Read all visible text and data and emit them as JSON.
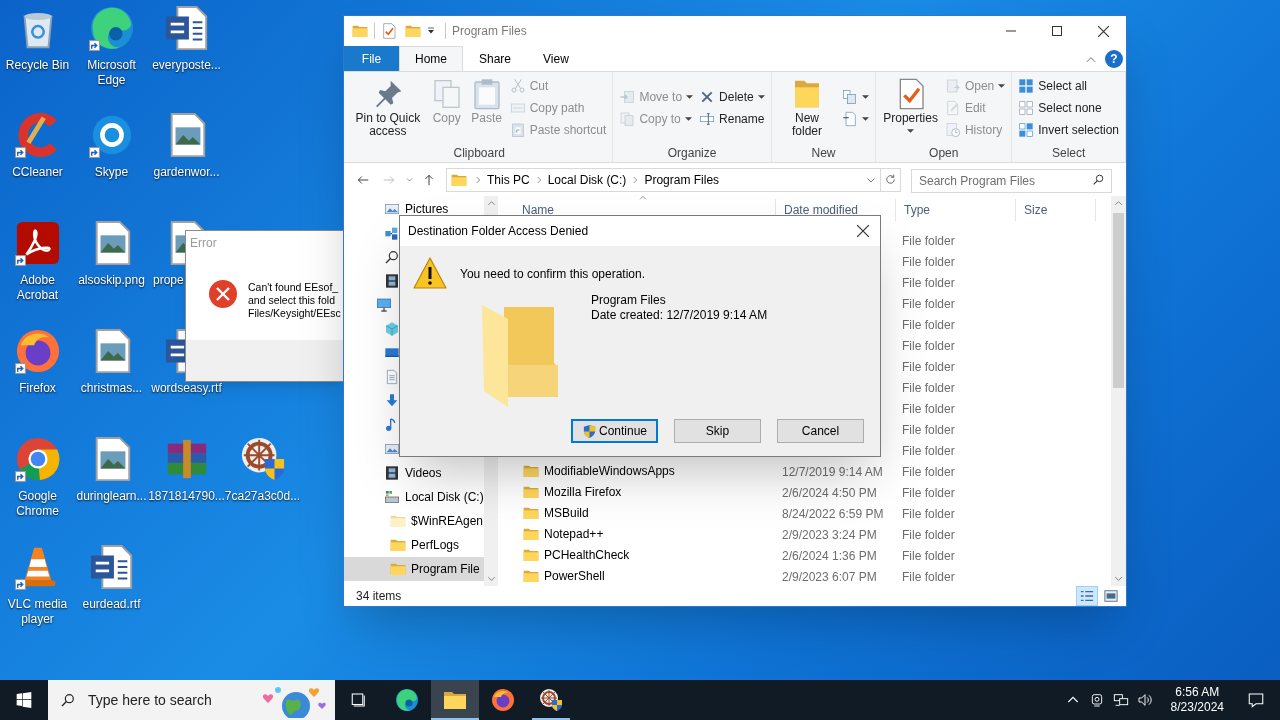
{
  "desktop_icons": [
    {
      "label": "Recycle Bin",
      "kind": "recycle",
      "shortcut": false
    },
    {
      "label": "CCleaner",
      "kind": "ccleaner",
      "shortcut": true
    },
    {
      "label": "Adobe Acrobat",
      "kind": "acrobat",
      "shortcut": true
    },
    {
      "label": "Firefox",
      "kind": "firefox",
      "shortcut": true
    },
    {
      "label": "Google Chrome",
      "kind": "chrome",
      "shortcut": true
    },
    {
      "label": "VLC media player",
      "kind": "vlc",
      "shortcut": true
    },
    {
      "label": "Microsoft Edge",
      "kind": "edge",
      "shortcut": true
    },
    {
      "label": "Skype",
      "kind": "skype",
      "shortcut": true
    },
    {
      "label": "alsoskip.png",
      "kind": "image",
      "shortcut": false
    },
    {
      "label": "christmas...",
      "kind": "image",
      "shortcut": false
    },
    {
      "label": "duringlearn...",
      "kind": "image",
      "shortcut": false
    },
    {
      "label": "eurdead.rtf",
      "kind": "word",
      "shortcut": false
    },
    {
      "label": "everyposte...",
      "kind": "word",
      "shortcut": false
    },
    {
      "label": "gardenwor...",
      "kind": "image",
      "shortcut": false
    },
    {
      "label": "prope",
      "kind": "image",
      "shortcut": false
    },
    {
      "label": "wordseasy.rtf",
      "kind": "word",
      "shortcut": false
    },
    {
      "label": "1871814790...",
      "kind": "winrar",
      "shortcut": false
    },
    {
      "label": "7ca27a3c0d...",
      "kind": "setup",
      "shortcut": false
    }
  ],
  "error_window": {
    "title": "Error",
    "message_lines": [
      "Can't found EEsof_",
      "and select this fold",
      "Files/Keysight/EEsc"
    ]
  },
  "explorer": {
    "title": "Program Files",
    "help": "?",
    "tabs": [
      {
        "label": "File",
        "kind": "file",
        "selected": false
      },
      {
        "label": "Home",
        "kind": "tab",
        "selected": true
      },
      {
        "label": "Share",
        "kind": "tab",
        "selected": false
      },
      {
        "label": "View",
        "kind": "tab",
        "selected": false
      }
    ],
    "ribbon_groups": [
      {
        "label": "Clipboard",
        "columns": [
          [
            {
              "label": "Pin to Quick access",
              "kind": "pin",
              "disabled": false,
              "dropdown": false
            }
          ],
          [
            {
              "label": "Copy",
              "kind": "copy",
              "disabled": true,
              "dropdown": false
            }
          ],
          [
            {
              "label": "Paste",
              "kind": "paste",
              "disabled": true,
              "dropdown": false
            }
          ],
          [
            {
              "label": "Cut",
              "kind": "cut",
              "disabled": true,
              "dropdown": false
            },
            {
              "label": "Copy path",
              "kind": "copypath",
              "disabled": true,
              "dropdown": false
            },
            {
              "label": "Paste shortcut",
              "kind": "pasteshortcut",
              "disabled": true,
              "dropdown": false
            }
          ]
        ]
      },
      {
        "label": "Organize",
        "columns": [
          [
            {
              "label": "Move to",
              "kind": "moveto",
              "disabled": true,
              "dropdown": true
            },
            {
              "label": "Copy to",
              "kind": "copyto",
              "disabled": true,
              "dropdown": true
            }
          ],
          [
            {
              "label": "Delete",
              "kind": "delete",
              "disabled": false,
              "dropdown": true
            },
            {
              "label": "Rename",
              "kind": "rename",
              "disabled": false,
              "dropdown": false
            }
          ]
        ]
      },
      {
        "label": "New",
        "columns": [
          [
            {
              "label": "New folder",
              "kind": "newfolder",
              "disabled": false,
              "dropdown": false
            }
          ],
          [
            {
              "kind": "newitem",
              "disabled": false,
              "dropdown": true
            },
            {
              "kind": "easyaccess",
              "disabled": false,
              "dropdown": true
            }
          ]
        ]
      },
      {
        "label": "Open",
        "columns": [
          [
            {
              "label": "Properties",
              "kind": "properties",
              "disabled": false,
              "dropdown": true
            }
          ],
          [
            {
              "label": "Open",
              "kind": "open",
              "disabled": true,
              "dropdown": true
            },
            {
              "label": "Edit",
              "kind": "edit",
              "disabled": true,
              "dropdown": false
            },
            {
              "label": "History",
              "kind": "history",
              "disabled": true,
              "dropdown": false
            }
          ]
        ]
      },
      {
        "label": "Select",
        "columns": [
          [
            {
              "label": "Select all",
              "kind": "selectall",
              "disabled": false,
              "dropdown": false
            },
            {
              "label": "Select none",
              "kind": "selectnone",
              "disabled": false,
              "dropdown": false
            },
            {
              "label": "Invert selection",
              "kind": "invert",
              "disabled": false,
              "dropdown": false
            }
          ]
        ]
      }
    ],
    "address": {
      "crumbs": [
        "This PC",
        "Local Disk (C:)",
        "Program Files"
      ],
      "search_placeholder": "Search Program Files"
    },
    "quick_access": [
      {
        "label": "Pictures",
        "kind": "pictures",
        "selected": false
      },
      {
        "kind": "blocks",
        "selected": false
      },
      {
        "kind": "search",
        "selected": false
      },
      {
        "kind": "film",
        "selected": false
      }
    ],
    "this_pc": {
      "kind": "pc",
      "selected": false,
      "children": [
        {
          "kind": "cube",
          "selected": false
        },
        {
          "kind": "desktop",
          "selected": false
        },
        {
          "kind": "document",
          "selected": false
        },
        {
          "kind": "download",
          "selected": false
        },
        {
          "kind": "music",
          "selected": false
        },
        {
          "kind": "pictures",
          "selected": false
        },
        {
          "label": "Videos",
          "kind": "film",
          "selected": false
        },
        {
          "label": "Local Disk (C:)",
          "kind": "disk",
          "selected": false,
          "children": [
            {
              "label": "$WinREAgen",
              "kind": "folder_light",
              "selected": false
            },
            {
              "label": "PerfLogs",
              "kind": "folder",
              "selected": false
            },
            {
              "label": "Program File",
              "kind": "folder",
              "selected": true
            }
          ]
        }
      ]
    },
    "columns": [
      {
        "label": "Name",
        "sorted": true
      },
      {
        "label": "Date modified",
        "sorted": false
      },
      {
        "label": "Type",
        "sorted": false
      },
      {
        "label": "Size",
        "sorted": false
      }
    ],
    "rows": [
      {
        "type": "File folder"
      },
      {
        "type": "File folder"
      },
      {
        "type": "File folder"
      },
      {
        "type": "File folder"
      },
      {
        "type": "File folder"
      },
      {
        "type": "File folder"
      },
      {
        "type": "File folder"
      },
      {
        "type": "File folder"
      },
      {
        "type": "File folder"
      },
      {
        "type": "File folder"
      },
      {
        "type": "File folder"
      },
      {
        "name": "ModifiableWindowsApps",
        "date": "12/7/2019 9:14 AM",
        "type": "File folder"
      },
      {
        "name": "Mozilla Firefox",
        "date": "2/6/2024 4:50 PM",
        "type": "File folder"
      },
      {
        "name": "MSBuild",
        "date": "8/24/2022 6:59 PM",
        "type": "File folder"
      },
      {
        "name": "Notepad++",
        "date": "2/9/2023 3:24 PM",
        "type": "File folder"
      },
      {
        "name": "PCHealthCheck",
        "date": "2/6/2024 1:36 PM",
        "type": "File folder"
      },
      {
        "name": "PowerShell",
        "date": "2/9/2023 6:07 PM",
        "type": "File folder"
      }
    ],
    "status": {
      "item_count": "34 items",
      "views": [
        {
          "kind": "details",
          "selected": true
        },
        {
          "kind": "large_icons",
          "selected": false
        }
      ]
    }
  },
  "dialog": {
    "title": "Destination Folder Access Denied",
    "message": "You need to confirm this operation.",
    "item_name": "Program Files",
    "item_detail": "Date created: 12/7/2019 9:14 AM",
    "buttons": [
      {
        "label": "Continue",
        "shield": true,
        "default": true
      },
      {
        "label": "Skip",
        "shield": false,
        "default": false
      },
      {
        "label": "Cancel",
        "shield": false,
        "default": false
      }
    ]
  },
  "taskbar": {
    "search_placeholder": "Type here to search",
    "apps": [
      {
        "kind": "edge",
        "active": false,
        "running": false
      },
      {
        "kind": "folder",
        "active": true,
        "running": true
      },
      {
        "kind": "firefox",
        "active": false,
        "running": false
      },
      {
        "kind": "setup",
        "active": false,
        "running": true
      }
    ],
    "time": "6:56 AM",
    "date": "8/23/2024"
  }
}
